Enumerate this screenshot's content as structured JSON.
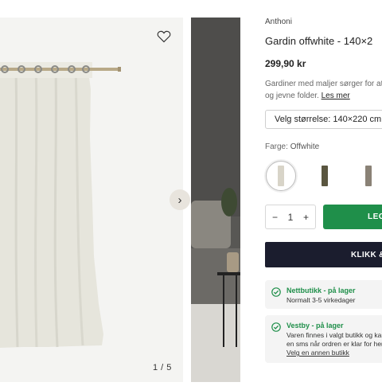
{
  "gallery": {
    "counter": "1 / 5",
    "favorite_icon": "heart-icon",
    "next_icon": "chevron-right-icon"
  },
  "product": {
    "brand": "Anthoni",
    "title": "Gardin offwhite - 140×2",
    "price": "299,90 kr",
    "description_line1": "Gardiner med maljer sørger for at g",
    "description_line2": "og jevne folder.",
    "read_more": "Les mer",
    "size_select": "Velg størrelse: 140×220 cm",
    "color_label": "Farge:",
    "color_value": "Offwhite",
    "swatches": [
      {
        "name": "offwhite",
        "color": "#d8d4c8"
      },
      {
        "name": "olive",
        "color": "#5a5640"
      },
      {
        "name": "grey",
        "color": "#8a8276"
      }
    ]
  },
  "purchase": {
    "quantity": "1",
    "minus": "−",
    "plus": "+",
    "add_button": "LEG",
    "click_button": "KLIKK & H"
  },
  "availability": {
    "online_title": "Nettbutikk - på lager",
    "online_text": "Normalt 3-5 virkedager",
    "store_title": "Vestby - på lager",
    "store_text1": "Varen finnes i valgt butikk og kan",
    "store_text2": "en sms når ordren er klar for hen",
    "store_link": "Velg en annen butikk"
  },
  "colors": {
    "accent_green": "#1f8f4a",
    "dark_button": "#1b1d2e"
  }
}
